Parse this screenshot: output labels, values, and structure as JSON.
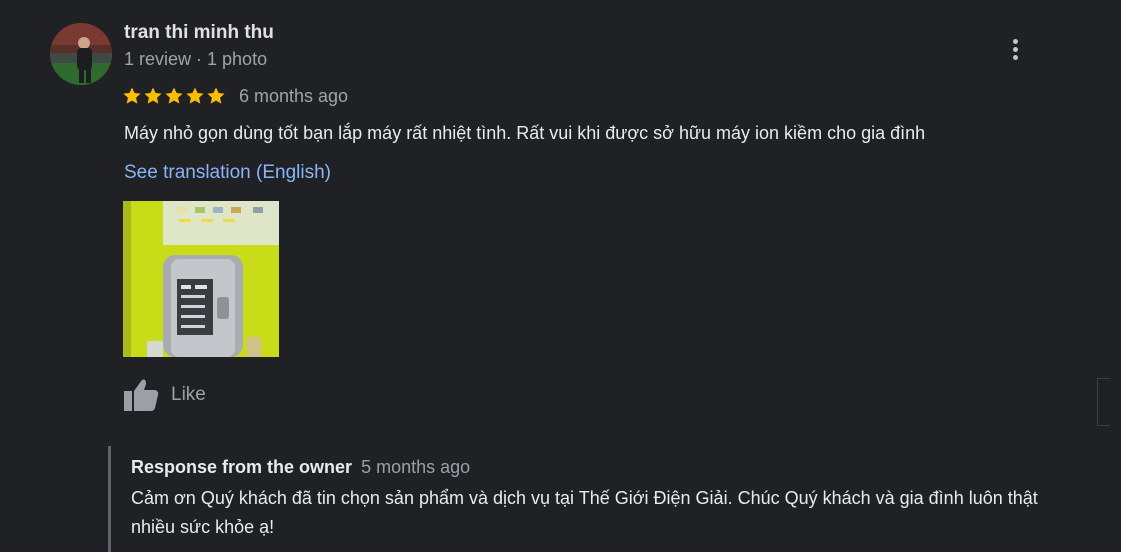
{
  "reviewer": {
    "name": "tran thi minh thu",
    "meta": "1 review · 1 photo"
  },
  "review": {
    "rating": 5,
    "rating_max": 5,
    "star_color": "#fbbc04",
    "date": "6 months ago",
    "text": "Máy nhỏ gọn dùng tốt bạn lắp máy rất nhiệt tình. Rất vui khi được sở hữu máy ion kiềm cho gia đình",
    "translate_link": "See translation (English)"
  },
  "actions": {
    "like_label": "Like"
  },
  "owner_response": {
    "title": "Response from the owner",
    "date": "5 months ago",
    "text": "Cảm ơn Quý khách đã tin chọn sản phẩm và dịch vụ tại Thế Giới Điện Giải. Chúc Quý khách và gia đình luôn thật nhiều sức khỏe ạ!"
  },
  "colors": {
    "background": "#202124",
    "link": "#8ab4f8",
    "secondary_text": "#a0a4a8"
  },
  "icons": {
    "more": "more-vert-icon",
    "star": "star-icon",
    "like": "thumb-up-icon"
  }
}
